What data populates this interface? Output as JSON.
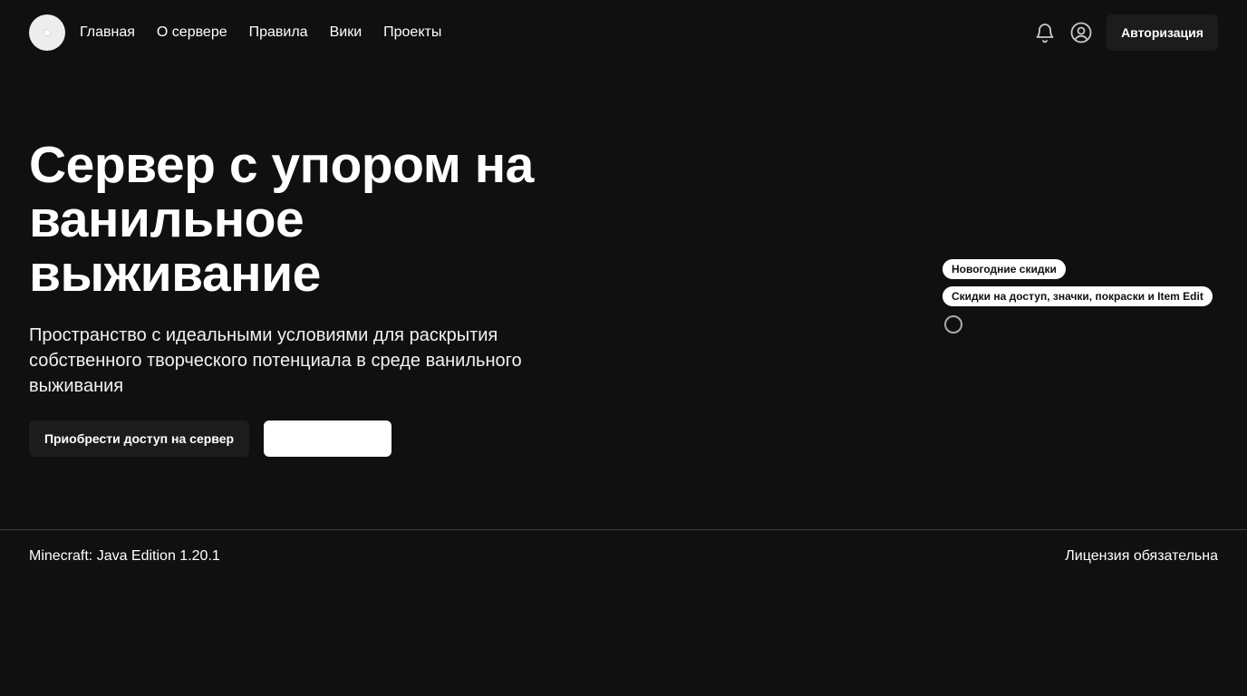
{
  "header": {
    "logo_icon": "server-logo-icon",
    "nav": [
      {
        "label": "Главная"
      },
      {
        "label": "О сервере"
      },
      {
        "label": "Правила"
      },
      {
        "label": "Вики"
      },
      {
        "label": "Проекты"
      }
    ],
    "bell_icon": "bell-icon",
    "user_icon": "user-circle-icon",
    "auth_label": "Авторизация"
  },
  "hero": {
    "title": "Сервер с упором на ванильное выживание",
    "subtitle": "Пространство с идеальными условиями для раскрытия собственного творческого потенциала в среде ванильного выживания",
    "buy_label": "Приобрести доступ на сервер"
  },
  "promos": [
    {
      "label": "Новогодние скидки"
    },
    {
      "label": "Скидки на доступ, значки, покраски и Item Edit"
    }
  ],
  "footer": {
    "version": "Minecraft: Java Edition 1.20.1",
    "license": "Лицензия обязательна"
  },
  "colors": {
    "background": "#101011",
    "button_dark": "#1c1c1e",
    "text": "#ffffff"
  }
}
